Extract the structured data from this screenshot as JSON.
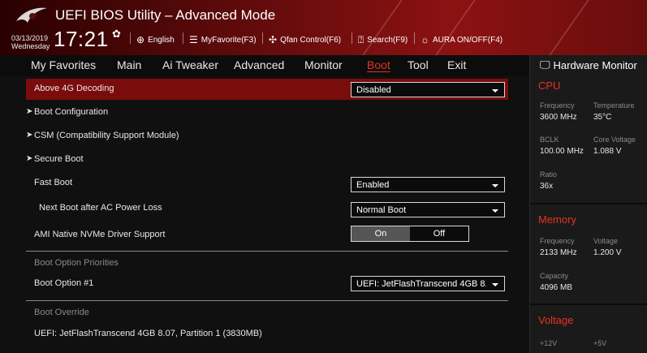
{
  "header": {
    "title": "UEFI BIOS Utility – Advanced Mode",
    "date": "03/13/2019",
    "day": "Wednesday",
    "time": "17:21",
    "toolbar": {
      "language": "English",
      "my_favorite": "MyFavorite(F3)",
      "qfan": "Qfan Control(F6)",
      "search": "Search(F9)",
      "aura": "AURA ON/OFF(F4)"
    }
  },
  "menu": {
    "tabs": [
      "My Favorites",
      "Main",
      "Ai Tweaker",
      "Advanced",
      "Monitor",
      "Boot",
      "Tool",
      "Exit"
    ],
    "active": "Boot"
  },
  "boot": {
    "above4g": {
      "label": "Above 4G Decoding",
      "value": "Disabled"
    },
    "boot_config": "Boot Configuration",
    "csm": "CSM (Compatibility Support Module)",
    "secure_boot": "Secure Boot",
    "fast_boot": {
      "label": "Fast Boot",
      "value": "Enabled"
    },
    "next_boot": {
      "label": "Next Boot after AC Power Loss",
      "value": "Normal Boot"
    },
    "nvme": {
      "label": "AMI Native NVMe Driver Support",
      "on": "On",
      "off": "Off"
    },
    "priorities_header": "Boot Option Priorities",
    "boot_option1": {
      "label": "Boot Option #1",
      "value": "UEFI: JetFlashTranscend 4GB 8.0"
    },
    "override_header": "Boot Override",
    "override_item": "UEFI: JetFlashTranscend 4GB 8.07, Partition 1 (3830MB)"
  },
  "hardware_monitor": {
    "title": "Hardware Monitor",
    "cpu": {
      "header": "CPU",
      "frequency_label": "Frequency",
      "frequency": "3600 MHz",
      "temperature_label": "Temperature",
      "temperature": "35°C",
      "bclk_label": "BCLK",
      "bclk": "100.00 MHz",
      "core_voltage_label": "Core Voltage",
      "core_voltage": "1.088 V",
      "ratio_label": "Ratio",
      "ratio": "36x"
    },
    "memory": {
      "header": "Memory",
      "frequency_label": "Frequency",
      "frequency": "2133 MHz",
      "voltage_label": "Voltage",
      "voltage": "1.200 V",
      "capacity_label": "Capacity",
      "capacity": "4096 MB"
    },
    "voltage": {
      "header": "Voltage",
      "v12_label": "+12V",
      "v5_label": "+5V"
    }
  },
  "colors": {
    "accent": "#e8331f",
    "selected_row": "#7a0c0c",
    "header_red": "#8c1212"
  }
}
